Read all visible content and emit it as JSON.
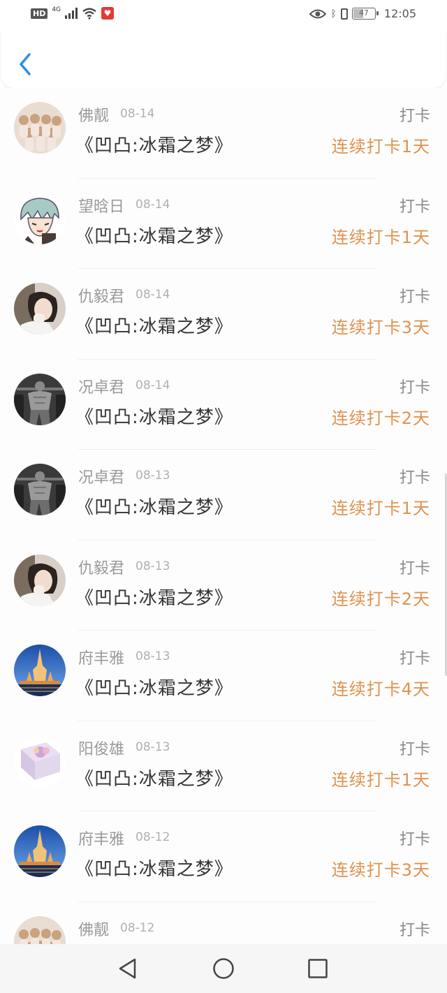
{
  "status_bar": {
    "hd": "HD",
    "network": "4G",
    "battery": "47",
    "time": "12:05",
    "icons": [
      "hd-icon",
      "signal-icon",
      "wifi-icon",
      "app-notification-icon",
      "eye-icon",
      "bluetooth-icon",
      "vibrate-icon",
      "battery-icon"
    ]
  },
  "header": {
    "back_icon": "chevron-left-icon"
  },
  "colors": {
    "accent": "#2a8fe6",
    "streak": "#e0924f",
    "name": "#9a9a9a"
  },
  "items": [
    {
      "name": "佛靓",
      "date": "08-14",
      "title": "《凹凸:冰霜之梦》",
      "action": "打卡",
      "streak": "连续打卡1天",
      "avatar": "group-photo"
    },
    {
      "name": "望晗日",
      "date": "08-14",
      "title": "《凹凸:冰霜之梦》",
      "action": "打卡",
      "streak": "连续打卡1天",
      "avatar": "anime-character"
    },
    {
      "name": "仇毅君",
      "date": "08-14",
      "title": "《凹凸:冰霜之梦》",
      "action": "打卡",
      "streak": "连续打卡3天",
      "avatar": "girl-portrait"
    },
    {
      "name": "况卓君",
      "date": "08-14",
      "title": "《凹凸:冰霜之梦》",
      "action": "打卡",
      "streak": "连续打卡2天",
      "avatar": "bodybuilder"
    },
    {
      "name": "况卓君",
      "date": "08-13",
      "title": "《凹凸:冰霜之梦》",
      "action": "打卡",
      "streak": "连续打卡1天",
      "avatar": "bodybuilder"
    },
    {
      "name": "仇毅君",
      "date": "08-13",
      "title": "《凹凸:冰霜之梦》",
      "action": "打卡",
      "streak": "连续打卡2天",
      "avatar": "girl-portrait"
    },
    {
      "name": "府丰雅",
      "date": "08-13",
      "title": "《凹凸:冰霜之梦》",
      "action": "打卡",
      "streak": "连续打卡4天",
      "avatar": "temple-night"
    },
    {
      "name": "阳俊雄",
      "date": "08-13",
      "title": "《凹凸:冰霜之梦》",
      "action": "打卡",
      "streak": "连续打卡1天",
      "avatar": "flower-box"
    },
    {
      "name": "府丰雅",
      "date": "08-12",
      "title": "《凹凸:冰霜之梦》",
      "action": "打卡",
      "streak": "连续打卡3天",
      "avatar": "temple-night"
    },
    {
      "name": "佛靓",
      "date": "08-12",
      "title": "",
      "action": "打卡",
      "streak": "",
      "avatar": "group-photo"
    }
  ],
  "nav_bar": {
    "icons": [
      "back-triangle-icon",
      "home-circle-icon",
      "recents-square-icon"
    ]
  }
}
